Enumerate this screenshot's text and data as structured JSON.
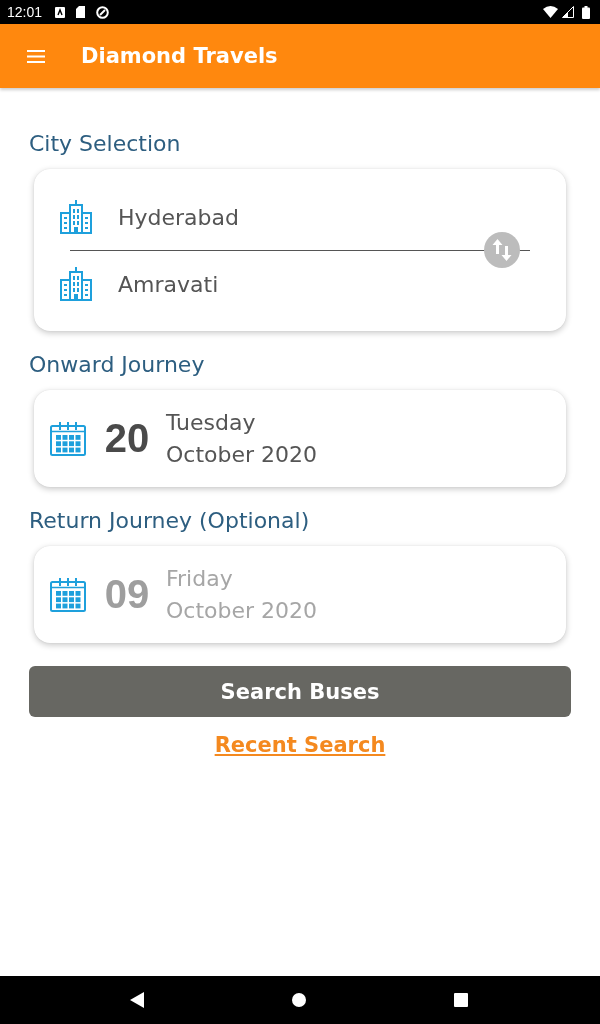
{
  "status_bar": {
    "time": "12:01"
  },
  "app_bar": {
    "title": "Diamond Travels"
  },
  "city_selection": {
    "label": "City Selection",
    "from": "Hyderabad",
    "to": "Amravati"
  },
  "journeys": [
    {
      "label": "Onward Journey",
      "day": "20",
      "weekday": "Tuesday",
      "month_year": "October 2020",
      "dimmed": false
    },
    {
      "label": "Return Journey (Optional)",
      "day": "09",
      "weekday": "Friday",
      "month_year": "October 2020",
      "dimmed": true
    }
  ],
  "search_button": "Search Buses",
  "recent_search_link": "Recent Search"
}
